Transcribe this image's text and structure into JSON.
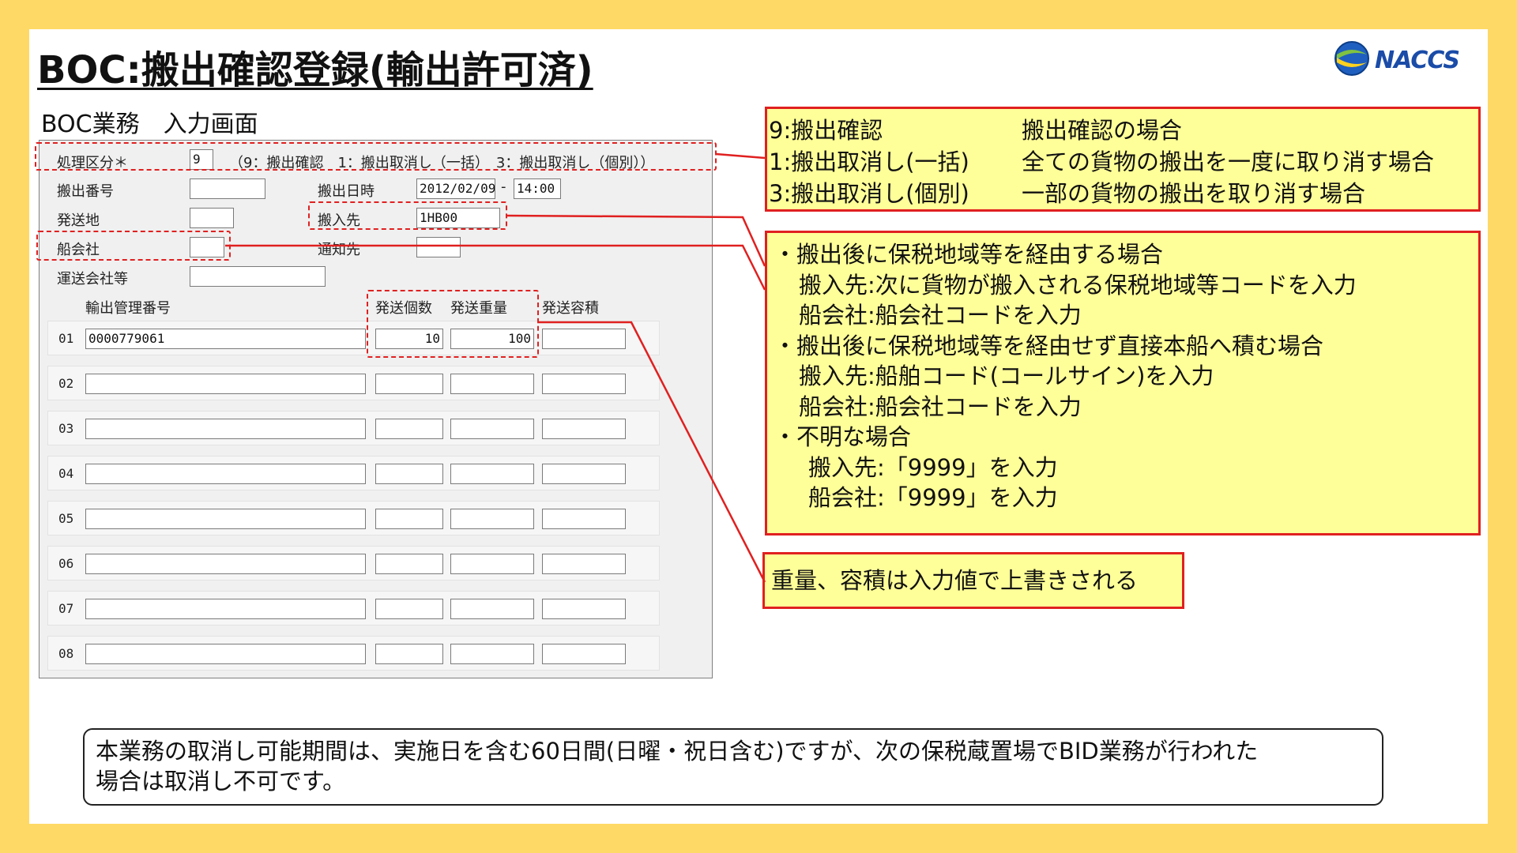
{
  "title": "BOC:搬出確認登録(輸出許可済)",
  "logo": {
    "text": "NACCS"
  },
  "screen_label": "BOC業務　入力画面",
  "form": {
    "shori_label": "処理区分＊",
    "shori_value": "9",
    "shori_hint": "（9：搬出確認　1：搬出取消し（一括）　3：搬出取消し（個別））",
    "hanshutsu_bango_label": "搬出番号",
    "hanshutsu_nichiji_label": "搬出日時",
    "date_value": "2012/02/09",
    "date_sep": "-",
    "time_value": "14:00",
    "hassochi_label": "発送地",
    "hannyusaki_label": "搬入先",
    "hannyusaki_value": "1HB00",
    "senkaisha_label": "船会社",
    "tsuchisaki_label": "通知先",
    "unsokaisha_label": "運送会社等",
    "col_yushutsu": "輸出管理番号",
    "col_kosu": "発送個数",
    "col_juryo": "発送重量",
    "col_yoseki": "発送容積",
    "rows": [
      {
        "no": "01",
        "number": "0000779061",
        "kosu": "10",
        "juryo": "100",
        "yoseki": ""
      },
      {
        "no": "02",
        "number": "",
        "kosu": "",
        "juryo": "",
        "yoseki": ""
      },
      {
        "no": "03",
        "number": "",
        "kosu": "",
        "juryo": "",
        "yoseki": ""
      },
      {
        "no": "04",
        "number": "",
        "kosu": "",
        "juryo": "",
        "yoseki": ""
      },
      {
        "no": "05",
        "number": "",
        "kosu": "",
        "juryo": "",
        "yoseki": ""
      },
      {
        "no": "06",
        "number": "",
        "kosu": "",
        "juryo": "",
        "yoseki": ""
      },
      {
        "no": "07",
        "number": "",
        "kosu": "",
        "juryo": "",
        "yoseki": ""
      },
      {
        "no": "08",
        "number": "",
        "kosu": "",
        "juryo": "",
        "yoseki": ""
      }
    ]
  },
  "note1": [
    {
      "k": "9:搬出確認",
      "v": "搬出確認の場合"
    },
    {
      "k": "1:搬出取消し(一括)",
      "v": "全ての貨物の搬出を一度に取り消す場合"
    },
    {
      "k": "3:搬出取消し(個別)",
      "v": "一部の貨物の搬出を取り消す場合"
    }
  ],
  "note2": [
    "・搬出後に保税地域等を経由する場合",
    "搬入先:次に貨物が搬入される保税地域等コードを入力",
    "船会社:船会社コードを入力",
    "・搬出後に保税地域等を経由せず直接本船へ積む場合",
    "搬入先:船舶コード(コールサイン)を入力",
    "船会社:船会社コードを入力",
    "・不明な場合",
    "搬入先:「9999」を入力",
    "船会社:「9999」を入力"
  ],
  "note3": "重量、容積は入力値で上書きされる",
  "footer": [
    "本業務の取消し可能期間は、実施日を含む60日間(日曜・祝日含む)ですが、次の保税蔵置場でBID業務が行われた",
    "場合は取消し不可です。"
  ],
  "colors": {
    "background": "#ffd966",
    "note_fill": "#ffff99",
    "accent_red": "#e02020"
  }
}
